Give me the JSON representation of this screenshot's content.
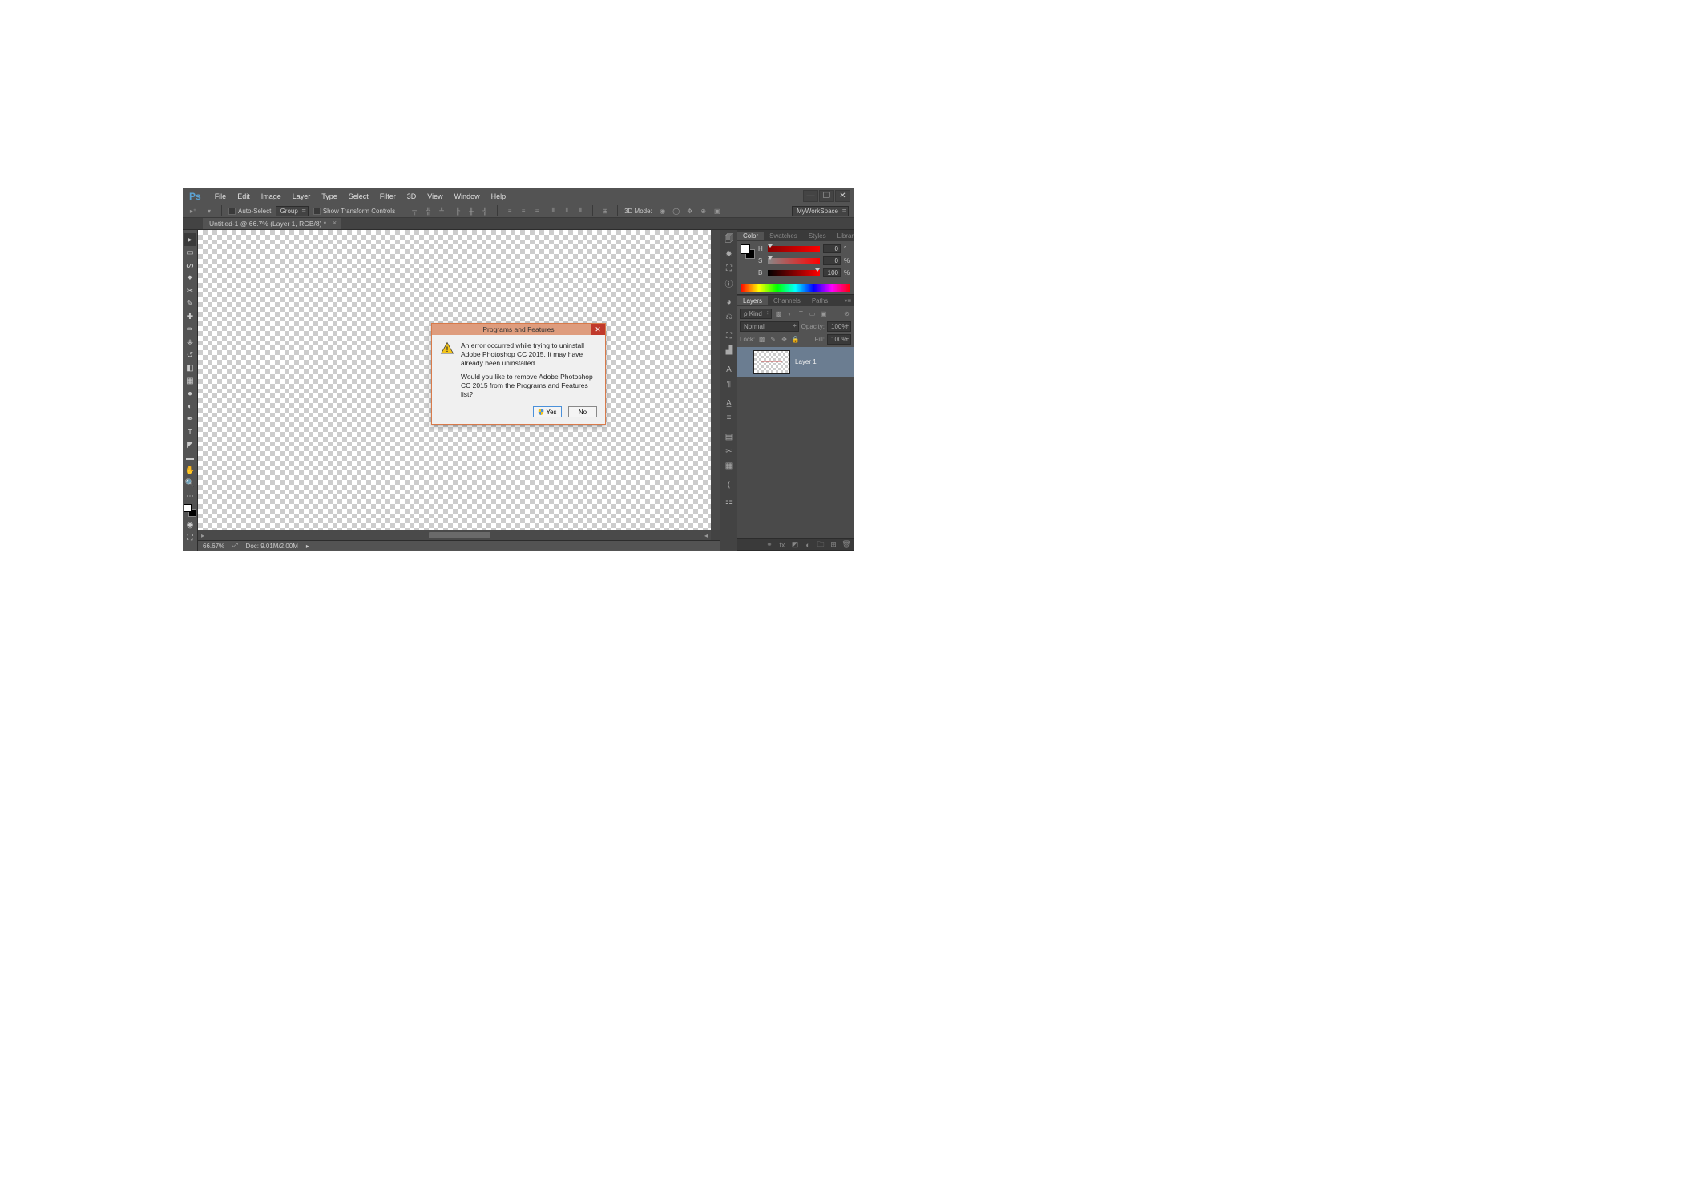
{
  "app": {
    "logo": "Ps"
  },
  "menu": [
    "File",
    "Edit",
    "Image",
    "Layer",
    "Type",
    "Select",
    "Filter",
    "3D",
    "View",
    "Window",
    "Help"
  ],
  "windowControls": {
    "min": "—",
    "max": "❐",
    "close": "✕"
  },
  "options": {
    "autoSelect": "Auto-Select:",
    "group": "Group",
    "showTransform": "Show Transform Controls",
    "mode3d": "3D Mode:",
    "workspace": "MyWorkSpace"
  },
  "document": {
    "tab": "Untitled-1 @ 66.7% (Layer 1, RGB/8) *"
  },
  "status": {
    "zoom": "66.67%",
    "doc": "Doc: 9.01M/2.00M"
  },
  "panels": {
    "color": {
      "tabs": [
        "Color",
        "Swatches",
        "Styles",
        "Libraries"
      ],
      "h": {
        "label": "H",
        "value": "0",
        "unit": "°"
      },
      "s": {
        "label": "S",
        "value": "0",
        "unit": "%"
      },
      "b": {
        "label": "B",
        "value": "100",
        "unit": "%"
      }
    },
    "layers": {
      "tabs": [
        "Layers",
        "Channels",
        "Paths"
      ],
      "filter": "Kind",
      "blend": "Normal",
      "opacityLabel": "Opacity:",
      "opacity": "100%",
      "lockLabel": "Lock:",
      "fillLabel": "Fill:",
      "fill": "100%",
      "items": [
        {
          "name": "Layer 1"
        }
      ]
    }
  },
  "dialog": {
    "title": "Programs and Features",
    "msg1": "An error occurred while trying to uninstall Adobe Photoshop CC 2015. It may have already been uninstalled.",
    "msg2": "Would you like to remove Adobe Photoshop CC 2015 from the Programs and Features list?",
    "yes": "Yes",
    "no": "No"
  }
}
